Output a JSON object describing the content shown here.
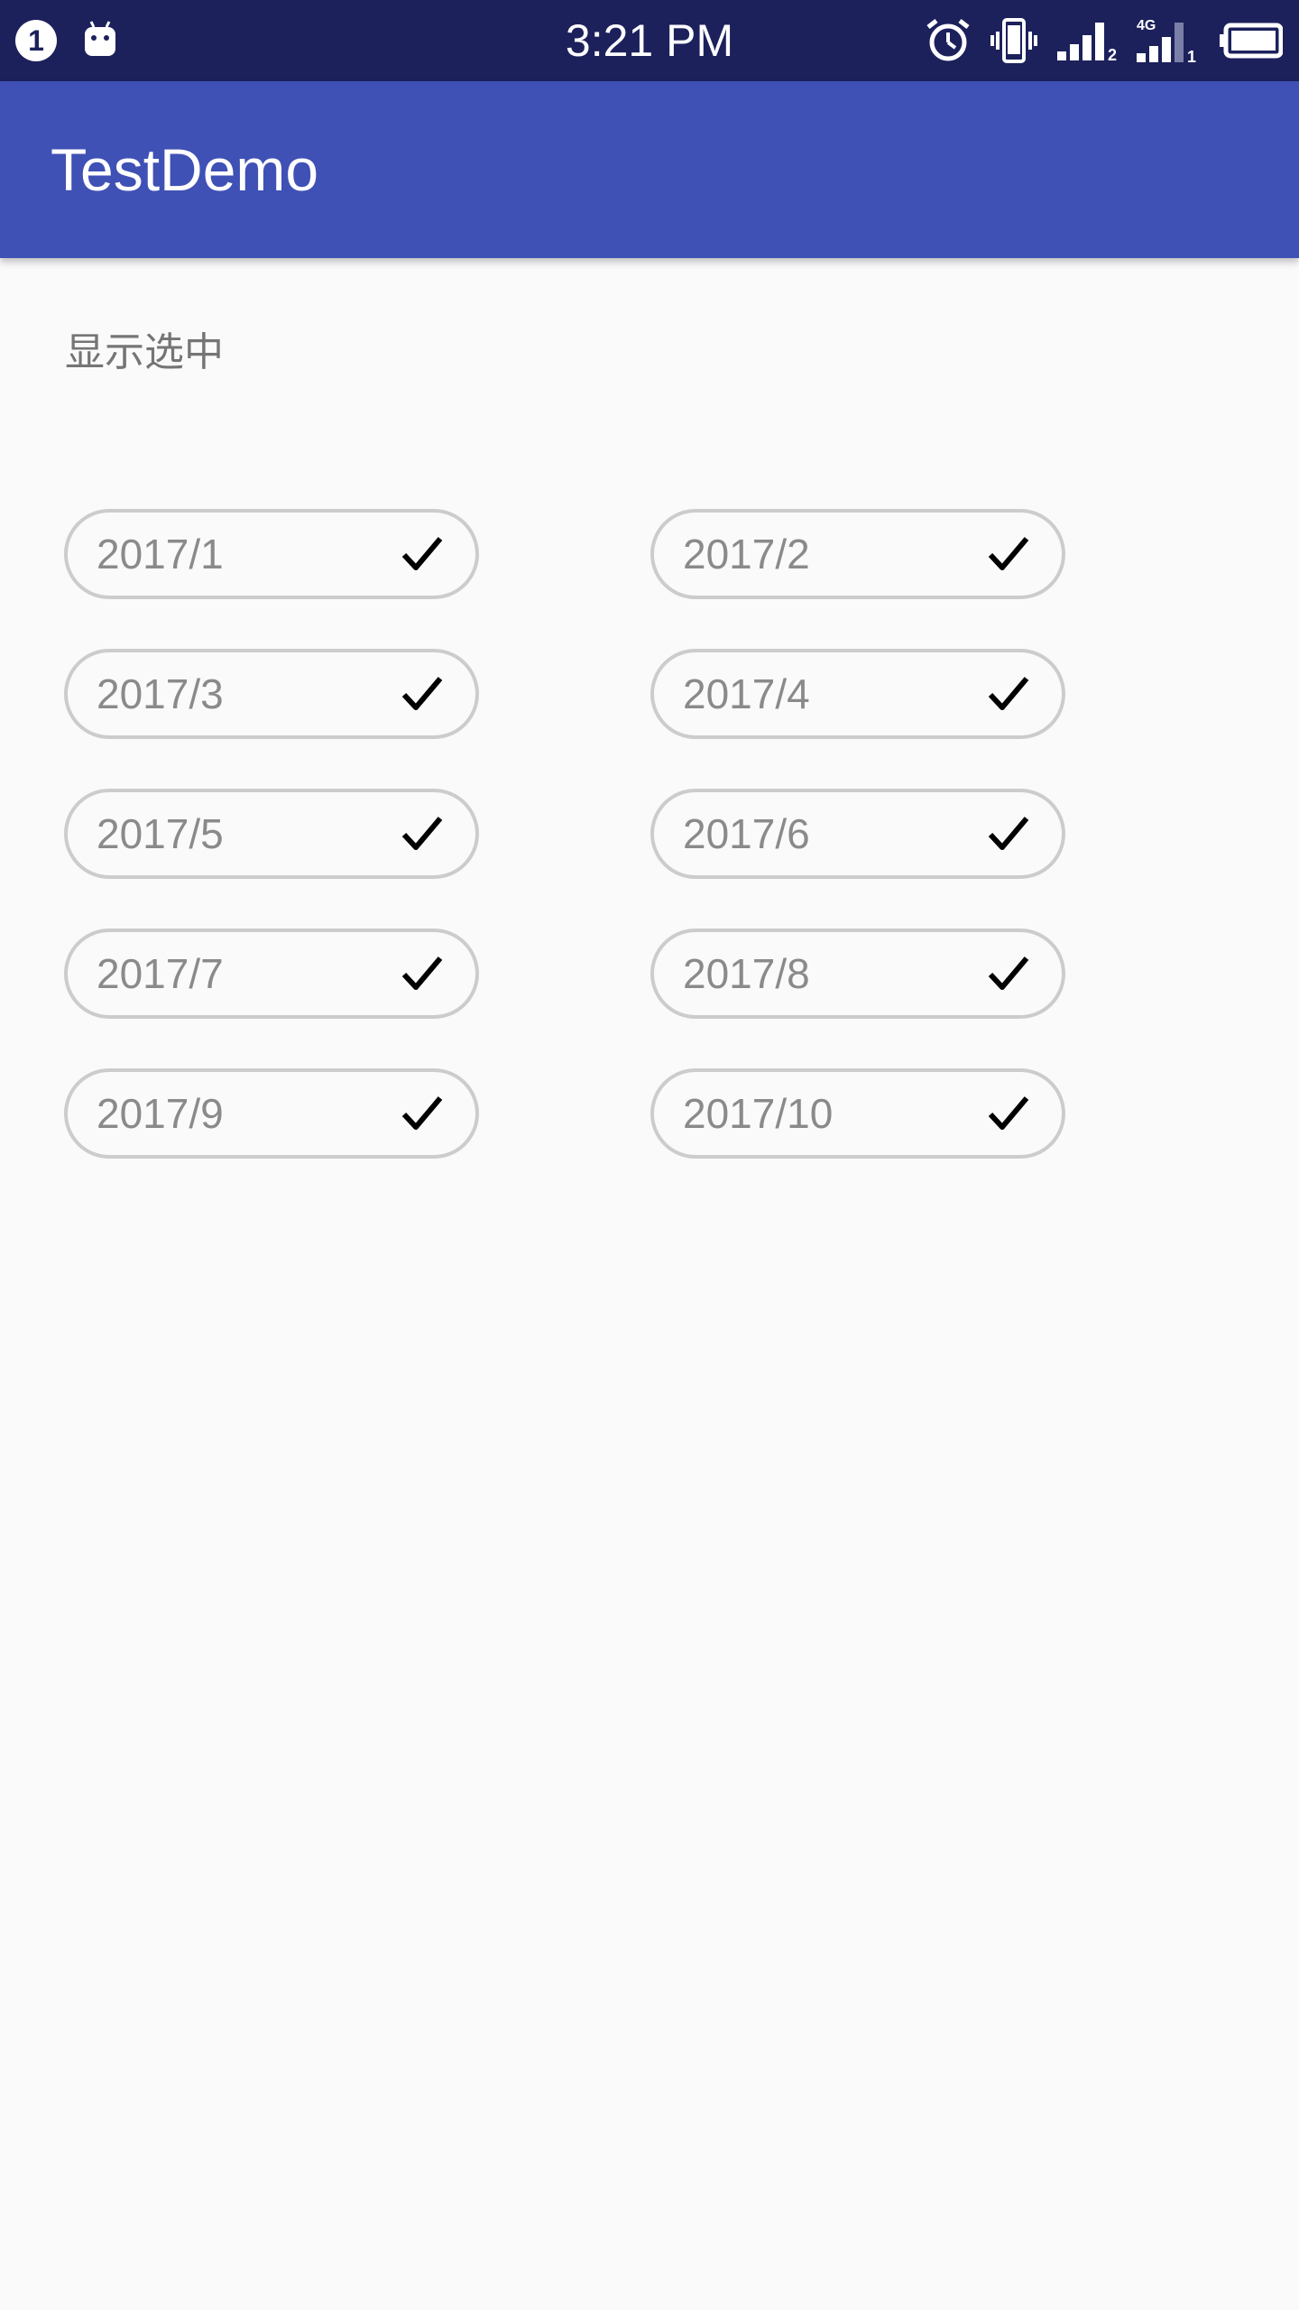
{
  "status_bar": {
    "notification_count": "1",
    "time": "3:21 PM",
    "network_label": "4G",
    "sim2_label": "2",
    "sim1_label": "1",
    "icons": [
      "notification-badge-icon",
      "android-icon",
      "alarm-icon",
      "vibrate-icon",
      "signal-icon",
      "signal-4g-icon",
      "battery-icon"
    ]
  },
  "app_bar": {
    "title": "TestDemo"
  },
  "main": {
    "show_selected_label": "显示选中",
    "chips": [
      {
        "label": "2017/1",
        "checked": true
      },
      {
        "label": "2017/2",
        "checked": true
      },
      {
        "label": "2017/3",
        "checked": true
      },
      {
        "label": "2017/4",
        "checked": true
      },
      {
        "label": "2017/5",
        "checked": true
      },
      {
        "label": "2017/6",
        "checked": true
      },
      {
        "label": "2017/7",
        "checked": true
      },
      {
        "label": "2017/8",
        "checked": true
      },
      {
        "label": "2017/9",
        "checked": true
      },
      {
        "label": "2017/10",
        "checked": true
      }
    ]
  },
  "colors": {
    "status_bar": "#1c215c",
    "app_bar": "#3f51b5",
    "background": "#fafafa",
    "chip_border": "#cccccc",
    "chip_text": "#8a8a8a",
    "check": "#000000"
  }
}
